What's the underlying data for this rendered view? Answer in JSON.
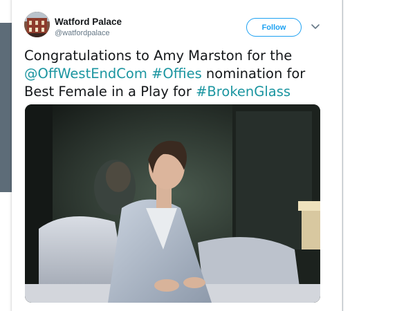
{
  "tweet": {
    "author_name": "Watford Palace",
    "author_handle": "@watfordpalace",
    "follow_label": "Follow",
    "text": {
      "part1": "Congratulations to Amy Marston for the",
      "mention": "@OffWestEndCom",
      "hashtag1": "#Offies",
      "part2": " nomination for",
      "part3": "Best Female in a Play for ",
      "hashtag2": "#BrokenGlass"
    },
    "icons": {
      "caret": "chevron-down-icon",
      "avatar": "theatre-building-avatar"
    }
  },
  "colors": {
    "link": "#1b95a0",
    "accent": "#1da1f2",
    "text": "#14171a",
    "secondary": "#657786"
  }
}
